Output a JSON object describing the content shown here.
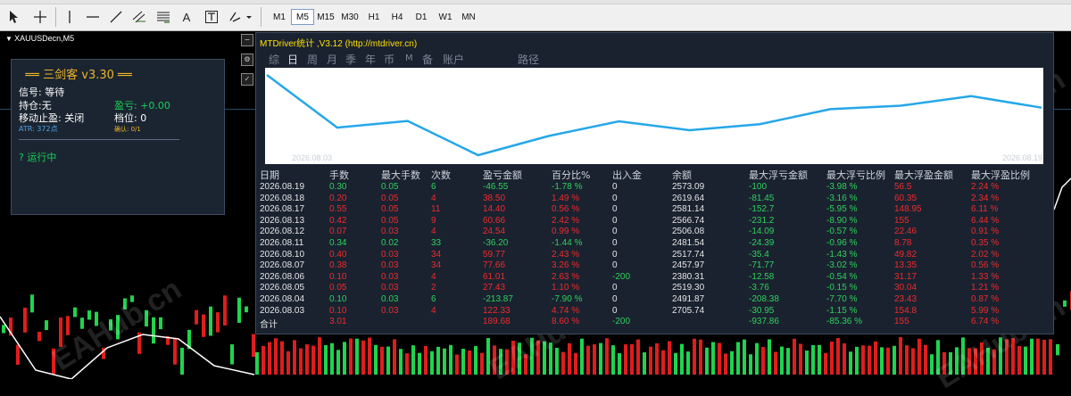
{
  "toolbar": {
    "icons": [
      "cursor-icon",
      "crosshair-icon",
      "vertical-line-icon",
      "horizontal-line-icon",
      "trendline-icon",
      "channel-icon",
      "fibonacci-icon",
      "text-icon",
      "text-label-icon",
      "shapes-icon"
    ],
    "text_tool_label": "A",
    "timeframes": [
      "M1",
      "M5",
      "M15",
      "M30",
      "H1",
      "H4",
      "D1",
      "W1",
      "MN"
    ],
    "active_timeframe": "M5"
  },
  "chart": {
    "symbol_title": "XAUUSDecn,M5"
  },
  "ea_panel": {
    "title": "══ 三剑客 v3.30 ══",
    "signal_label": "信号:",
    "signal_value": "等待",
    "position_label": "持仓:",
    "position_value": "无",
    "pnl_label": "盈亏:",
    "pnl_value": "+0.00",
    "trailing_label": "移动止盈:",
    "trailing_value": "关闭",
    "level_label": "档位:",
    "level_value": "0",
    "atr_label": "ATR:",
    "atr_value": "372点",
    "confirm_label": "确认: 0/1",
    "status": "? 运行中"
  },
  "mt_panel": {
    "title": "MTDriver统计 ,V3.12 (http://mtdriver.cn)",
    "tabs": [
      "综",
      "日",
      "周",
      "月",
      "季",
      "年",
      "币",
      "M",
      "备",
      "账户",
      "路径"
    ],
    "active_tab": "日",
    "start_date": "2026.08.03",
    "end_date": "2026.08.19",
    "columns": [
      "日期",
      "手数",
      "最大手数",
      "次数",
      "盈亏金额",
      "百分比%",
      "出入金",
      "余额",
      "最大浮亏金额",
      "最大浮亏比例",
      "最大浮盈金额",
      "最大浮盈比例"
    ],
    "rows": [
      {
        "date": "2026.08.19",
        "lots": "0.30",
        "max_lots": "0.05",
        "count": "6",
        "pnl": "-46.55",
        "pct": "-1.78 %",
        "flow": "0",
        "balance": "2573.09",
        "max_dd": "-100",
        "max_dd_pct": "-3.98 %",
        "max_fp": "56.5",
        "max_fp_pct": "2.24 %",
        "win": false
      },
      {
        "date": "2026.08.18",
        "lots": "0.20",
        "max_lots": "0.05",
        "count": "4",
        "pnl": "38.50",
        "pct": "1.49 %",
        "flow": "0",
        "balance": "2619.64",
        "max_dd": "-81.45",
        "max_dd_pct": "-3.16 %",
        "max_fp": "60.35",
        "max_fp_pct": "2.34 %",
        "win": true
      },
      {
        "date": "2026.08.17",
        "lots": "0.55",
        "max_lots": "0.05",
        "count": "11",
        "pnl": "14.40",
        "pct": "0.56 %",
        "flow": "0",
        "balance": "2581.14",
        "max_dd": "-152.7",
        "max_dd_pct": "-5.95 %",
        "max_fp": "148.95",
        "max_fp_pct": "6.11 %",
        "win": true
      },
      {
        "date": "2026.08.13",
        "lots": "0.42",
        "max_lots": "0.05",
        "count": "9",
        "pnl": "60.66",
        "pct": "2.42 %",
        "flow": "0",
        "balance": "2566.74",
        "max_dd": "-231.2",
        "max_dd_pct": "-8.90 %",
        "max_fp": "155",
        "max_fp_pct": "6.44 %",
        "win": true
      },
      {
        "date": "2026.08.12",
        "lots": "0.07",
        "max_lots": "0.03",
        "count": "4",
        "pnl": "24.54",
        "pct": "0.99 %",
        "flow": "0",
        "balance": "2506.08",
        "max_dd": "-14.09",
        "max_dd_pct": "-0.57 %",
        "max_fp": "22.46",
        "max_fp_pct": "0.91 %",
        "win": true
      },
      {
        "date": "2026.08.11",
        "lots": "0.34",
        "max_lots": "0.02",
        "count": "33",
        "pnl": "-36.20",
        "pct": "-1.44 %",
        "flow": "0",
        "balance": "2481.54",
        "max_dd": "-24.39",
        "max_dd_pct": "-0.96 %",
        "max_fp": "8.78",
        "max_fp_pct": "0.35 %",
        "win": false
      },
      {
        "date": "2026.08.10",
        "lots": "0.40",
        "max_lots": "0.03",
        "count": "34",
        "pnl": "59.77",
        "pct": "2.43 %",
        "flow": "0",
        "balance": "2517.74",
        "max_dd": "-35.4",
        "max_dd_pct": "-1.43 %",
        "max_fp": "49.82",
        "max_fp_pct": "2.02 %",
        "win": true
      },
      {
        "date": "2026.08.07",
        "lots": "0.38",
        "max_lots": "0.03",
        "count": "34",
        "pnl": "77.66",
        "pct": "3.26 %",
        "flow": "0",
        "balance": "2457.97",
        "max_dd": "-71.77",
        "max_dd_pct": "-3.02 %",
        "max_fp": "13.35",
        "max_fp_pct": "0.56 %",
        "win": true
      },
      {
        "date": "2026.08.06",
        "lots": "0.10",
        "max_lots": "0.03",
        "count": "4",
        "pnl": "61.01",
        "pct": "2.63 %",
        "flow": "-200",
        "balance": "2380.31",
        "max_dd": "-12.58",
        "max_dd_pct": "-0.54 %",
        "max_fp": "31.17",
        "max_fp_pct": "1.33 %",
        "win": true
      },
      {
        "date": "2026.08.05",
        "lots": "0.05",
        "max_lots": "0.03",
        "count": "2",
        "pnl": "27.43",
        "pct": "1.10 %",
        "flow": "0",
        "balance": "2519.30",
        "max_dd": "-3.76",
        "max_dd_pct": "-0.15 %",
        "max_fp": "30.04",
        "max_fp_pct": "1.21 %",
        "win": true
      },
      {
        "date": "2026.08.04",
        "lots": "0.10",
        "max_lots": "0.03",
        "count": "6",
        "pnl": "-213.87",
        "pct": "-7.90 %",
        "flow": "0",
        "balance": "2491.87",
        "max_dd": "-208.38",
        "max_dd_pct": "-7.70 %",
        "max_fp": "23.43",
        "max_fp_pct": "0.87 %",
        "win": false
      },
      {
        "date": "2026.08.03",
        "lots": "0.10",
        "max_lots": "0.03",
        "count": "4",
        "pnl": "122.33",
        "pct": "4.74 %",
        "flow": "0",
        "balance": "2705.74",
        "max_dd": "-30.95",
        "max_dd_pct": "-1.15 %",
        "max_fp": "154.8",
        "max_fp_pct": "5.99 %",
        "win": true
      }
    ],
    "total": {
      "label": "合计",
      "lots": "3.01",
      "pnl": "189.68",
      "pct": "8.60 %",
      "flow": "-200",
      "max_dd": "-937.86",
      "max_dd_pct": "-85.36 %",
      "max_fp": "155",
      "max_fp_pct": "6.74 %"
    }
  },
  "colors": {
    "profit": "#2fd15a",
    "loss": "#ee2b2b",
    "neutral": "#e6e6e6",
    "equity_line": "#25a7e8",
    "title_yellow": "#ffe000",
    "ea_gold": "#f0b428",
    "ea_green": "#18d05a",
    "ea_blue": "#4ea3e8"
  },
  "watermark": "EAHub.cn"
}
